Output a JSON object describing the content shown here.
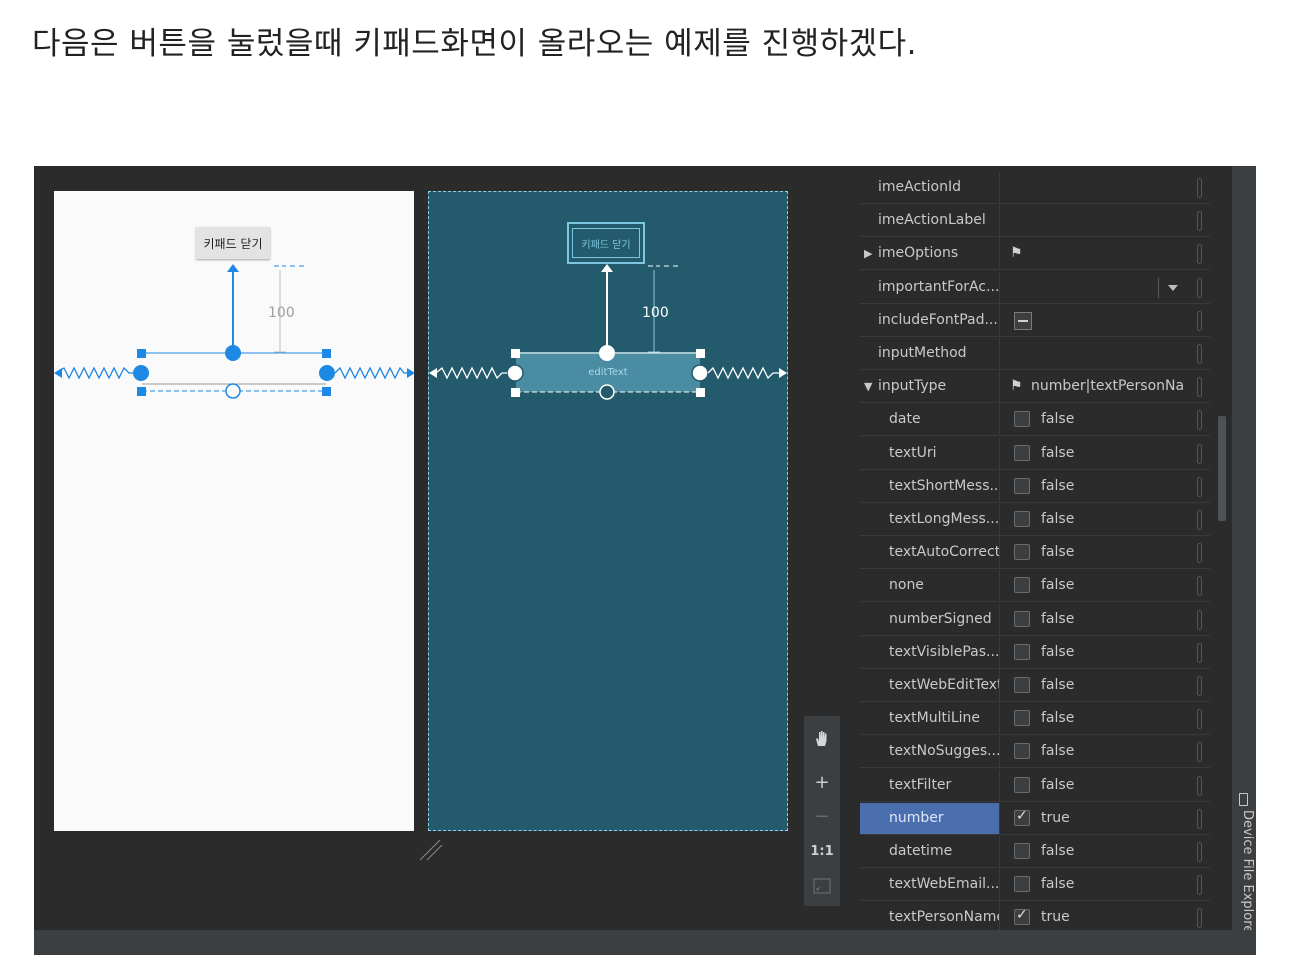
{
  "heading": "다음은 버튼을 눌렀을때 키패드화면이 올라오는 예제를 진행하겠다.",
  "design": {
    "button_label": "키패드 닫기",
    "margin_value": "100"
  },
  "blueprint": {
    "button_label": "키패드 닫기",
    "edittext_label": "editText",
    "margin_value": "100"
  },
  "toolbar": {
    "pan": "hand-icon",
    "zoom_in": "+",
    "zoom_out": "−",
    "actual_size": "1:1",
    "fit": "fit-screen-icon"
  },
  "properties": [
    {
      "name": "imeActionId",
      "kind": "empty"
    },
    {
      "name": "imeActionLabel",
      "kind": "empty"
    },
    {
      "name": "imeOptions",
      "kind": "flag",
      "expandable": "collapsed",
      "value": ""
    },
    {
      "name": "importantForAc...",
      "kind": "dropdown"
    },
    {
      "name": "includeFontPad...",
      "kind": "minus"
    },
    {
      "name": "inputMethod",
      "kind": "empty"
    },
    {
      "name": "inputType",
      "kind": "flag",
      "expandable": "expanded",
      "value": "number|textPersonNa"
    },
    {
      "name": "date",
      "kind": "check",
      "checked": false,
      "value": "false"
    },
    {
      "name": "textUri",
      "kind": "check",
      "checked": false,
      "value": "false"
    },
    {
      "name": "textShortMess...",
      "kind": "check",
      "checked": false,
      "value": "false"
    },
    {
      "name": "textLongMess...",
      "kind": "check",
      "checked": false,
      "value": "false"
    },
    {
      "name": "textAutoCorrect",
      "kind": "check",
      "checked": false,
      "value": "false"
    },
    {
      "name": "none",
      "kind": "check",
      "checked": false,
      "value": "false"
    },
    {
      "name": "numberSigned",
      "kind": "check",
      "checked": false,
      "value": "false"
    },
    {
      "name": "textVisiblePas...",
      "kind": "check",
      "checked": false,
      "value": "false"
    },
    {
      "name": "textWebEditText",
      "kind": "check",
      "checked": false,
      "value": "false"
    },
    {
      "name": "textMultiLine",
      "kind": "check",
      "checked": false,
      "value": "false"
    },
    {
      "name": "textNoSugges...",
      "kind": "check",
      "checked": false,
      "value": "false"
    },
    {
      "name": "textFilter",
      "kind": "check",
      "checked": false,
      "value": "false"
    },
    {
      "name": "number",
      "kind": "check",
      "checked": true,
      "value": "true",
      "selected": true
    },
    {
      "name": "datetime",
      "kind": "check",
      "checked": false,
      "value": "false"
    },
    {
      "name": "textWebEmail...",
      "kind": "check",
      "checked": false,
      "value": "false"
    },
    {
      "name": "textPersonName",
      "kind": "check",
      "checked": true,
      "value": "true"
    }
  ],
  "side_panel": {
    "label": "Device File Explorer"
  },
  "colors": {
    "selection_blue": "#1e88e5",
    "blueprint_bg": "#235a6c",
    "blueprint_line": "#ffffff",
    "selected_row": "#4b6eaf"
  }
}
